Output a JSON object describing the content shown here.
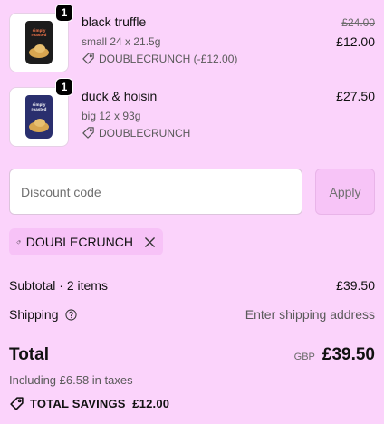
{
  "items": [
    {
      "title": "black truffle",
      "quantity": "1",
      "variant": "small 24 x 21.5g",
      "discount_text": "DOUBLECRUNCH (-£12.00)",
      "original_price": "£24.00",
      "price": "£12.00",
      "bag_color": "#1c1c1c",
      "bag_brand": "simply roasted"
    },
    {
      "title": "duck & hoisin",
      "quantity": "1",
      "variant": "big 12 x 93g",
      "discount_text": "DOUBLECRUNCH",
      "price": "£27.50",
      "bag_color": "#2a2f6e",
      "bag_brand": "simply roasted"
    }
  ],
  "discount": {
    "placeholder": "Discount code",
    "apply_label": "Apply",
    "applied_code": "DOUBLECRUNCH"
  },
  "summary": {
    "subtotal_label": "Subtotal · 2 items",
    "subtotal_value": "£39.50",
    "shipping_label": "Shipping",
    "shipping_value": "Enter shipping address",
    "total_label": "Total",
    "currency": "GBP",
    "total_value": "£39.50",
    "taxes_text": "Including £6.58 in taxes",
    "savings_text": "TOTAL SAVINGS  £12.00"
  },
  "colors": {
    "background": "#fbd3fb",
    "applied_tag_bg": "#f7c2f7",
    "apply_button_bg": "#f7c4f7"
  }
}
